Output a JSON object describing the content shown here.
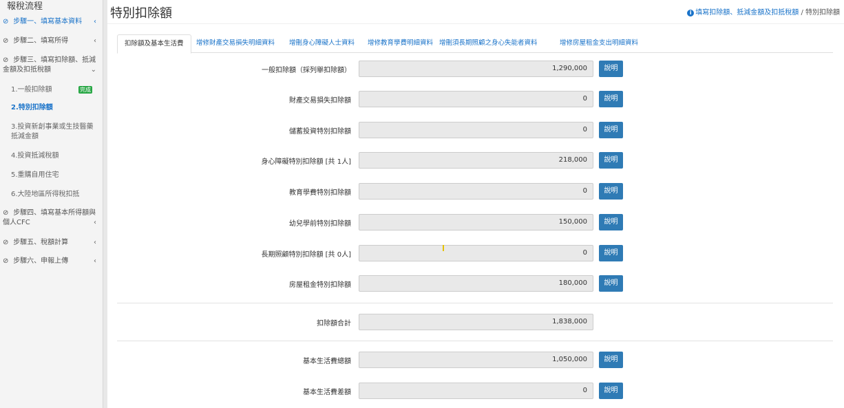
{
  "sidebar": {
    "title": "報稅流程",
    "steps": [
      {
        "label": "步驟一、填寫基本資料",
        "chevron": "‹"
      },
      {
        "label": "步驟二、填寫所得",
        "chevron": "‹"
      },
      {
        "label": "步驟三、填寫扣除額、抵減金額及扣抵稅額",
        "chevron": "⌄"
      },
      {
        "label": "步驟四、填寫基本所得額與個人CFC",
        "chevron": "‹"
      },
      {
        "label": "步驟五、稅額計算",
        "chevron": "‹"
      },
      {
        "label": "步驟六、申報上傳",
        "chevron": "‹"
      }
    ],
    "sub_items": [
      {
        "label": "1.一般扣除額",
        "badge": "完成"
      },
      {
        "label": "2.特別扣除額"
      },
      {
        "label": "3.投資新創事業或生技醫藥抵減金額"
      },
      {
        "label": "4.投資抵減稅額"
      },
      {
        "label": "5.重購自用住宅"
      },
      {
        "label": "6.大陸地區所得稅扣抵"
      }
    ]
  },
  "header": {
    "title": "特別扣除額",
    "breadcrumb_link": "填寫扣除額、抵減金額及扣抵稅額",
    "breadcrumb_sep": "/",
    "breadcrumb_current": "特別扣除額"
  },
  "tabs": [
    "扣除額及基本生活費",
    "增修財產交易損失明細資料",
    "增刪身心障礙人士資料",
    "增修教育學費明細資料",
    "增刪須長期照顧之身心失能者資料",
    "增修房屋租金支出明細資料"
  ],
  "rows": [
    {
      "label": "一般扣除額（採列舉扣除額）",
      "value": "1,290,000",
      "button": "說明"
    },
    {
      "label": "財產交易損失扣除額",
      "value": "0",
      "button": "說明"
    },
    {
      "label": "儲蓄投資特別扣除額",
      "value": "0",
      "button": "說明"
    },
    {
      "label": "身心障礙特別扣除額 [共 1人]",
      "value": "218,000",
      "button": "說明"
    },
    {
      "label": "教育學費特別扣除額",
      "value": "0",
      "button": "說明"
    },
    {
      "label": "幼兒學前特別扣除額",
      "value": "150,000",
      "button": "說明"
    },
    {
      "label": "長期照顧特別扣除額 [共 0人]",
      "value": "0",
      "button": "說明"
    },
    {
      "label": "房屋租金特別扣除額",
      "value": "180,000",
      "button": "說明"
    }
  ],
  "total": {
    "label": "扣除額合計",
    "value": "1,838,000"
  },
  "basic_living": [
    {
      "label": "基本生活費總額",
      "value": "1,050,000",
      "button": "說明"
    },
    {
      "label": "基本生活費差額",
      "value": "0",
      "button": "說明"
    }
  ],
  "icons": {
    "step": "link-icon",
    "info": "info-icon"
  },
  "colors": {
    "accent": "#1a73c9",
    "button": "#2f7bb5",
    "badge": "#28a745"
  }
}
